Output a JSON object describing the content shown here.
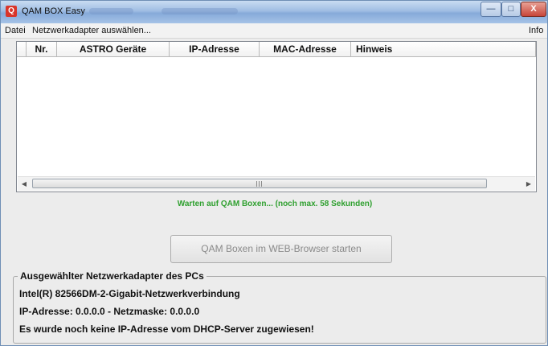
{
  "window": {
    "title": "QAM BOX Easy",
    "controls": {
      "minimize": "—",
      "maximize": "□",
      "close": "X"
    }
  },
  "menu": {
    "items": [
      "Datei",
      "Netzwerkadapter auswählen...",
      "Info"
    ]
  },
  "table": {
    "columns": [
      "Nr.",
      "ASTRO Geräte",
      "IP-Adresse",
      "MAC-Adresse",
      "Hinweis"
    ],
    "rows": []
  },
  "status": {
    "text": "Warten auf QAM Boxen...   (noch max. 58 Sekunden)",
    "color": "#2fa02f"
  },
  "buttons": {
    "open_web": "QAM Boxen im WEB-Browser starten"
  },
  "adapter_group": {
    "title": "Ausgewählter Netzwerkadapter des PCs",
    "adapter_name": "Intel(R) 82566DM-2-Gigabit-Netzwerkverbindung",
    "ip_line": "IP-Adresse: 0.0.0.0  -  Netzmaske: 0.0.0.0",
    "dhcp_message": "Es wurde noch keine IP-Adresse vom DHCP-Server zugewiesen!"
  }
}
